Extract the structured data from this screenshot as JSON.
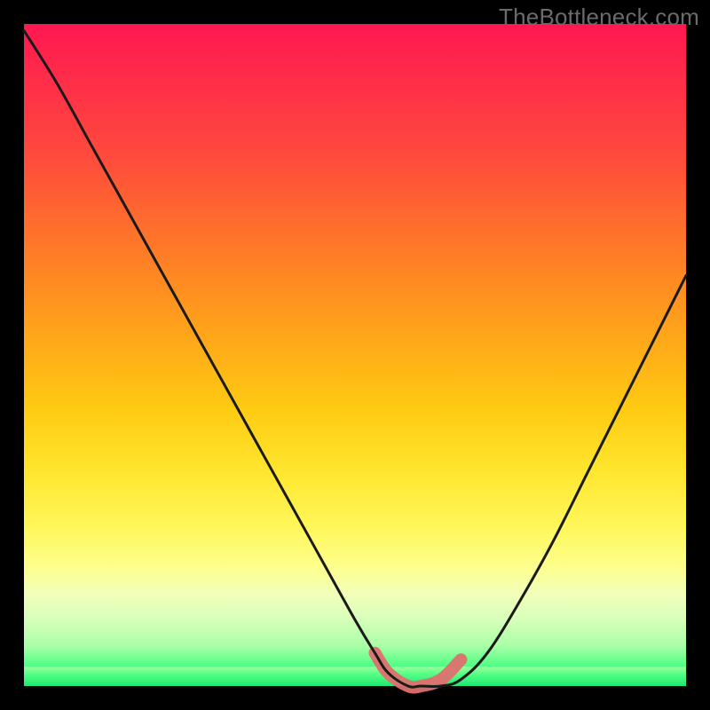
{
  "watermark": "TheBottleneck.com",
  "chart_data": {
    "type": "line",
    "title": "",
    "xlabel": "",
    "ylabel": "",
    "xlim": [
      0,
      100
    ],
    "ylim": [
      0,
      100
    ],
    "grid": false,
    "legend": false,
    "series": [
      {
        "name": "curve",
        "x": [
          0,
          5,
          10,
          15,
          20,
          25,
          30,
          35,
          40,
          45,
          50,
          53,
          55,
          58,
          60,
          63,
          66,
          70,
          75,
          80,
          85,
          90,
          95,
          100
        ],
        "y": [
          99,
          91,
          82,
          73,
          64,
          55,
          46,
          37,
          28,
          19,
          10,
          5,
          2,
          0,
          0,
          0,
          1,
          5,
          13,
          22,
          32,
          42,
          52,
          62
        ]
      }
    ],
    "highlight_basin": {
      "x": [
        53,
        55,
        58,
        60,
        63,
        66
      ],
      "y": [
        5,
        2,
        0,
        0,
        1,
        4
      ]
    },
    "background_gradient": {
      "top": "#ff1750",
      "bottom": "#19e872"
    }
  }
}
